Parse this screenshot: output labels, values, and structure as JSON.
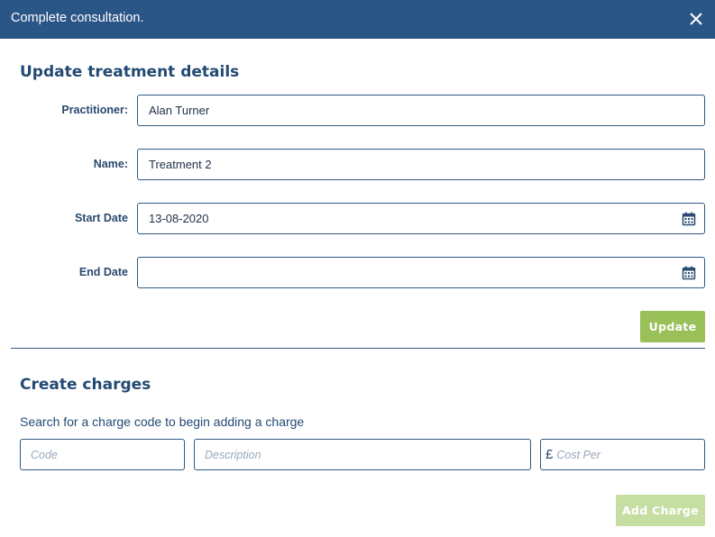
{
  "dialog": {
    "title": "Complete consultation.",
    "close_icon": "close-icon"
  },
  "treatment": {
    "heading": "Update treatment details",
    "practitioner_label": "Practitioner:",
    "practitioner_value": "Alan Turner",
    "name_label": "Name:",
    "name_value": "Treatment 2",
    "start_date_label": "Start Date",
    "start_date_value": "13-08-2020",
    "end_date_label": "End Date",
    "end_date_value": "",
    "calendar_icon": "calendar-icon",
    "update_label": "Update"
  },
  "charges": {
    "heading": "Create charges",
    "help_text": "Search for a charge code to begin adding a charge",
    "code_placeholder": "Code",
    "description_placeholder": "Description",
    "currency_symbol": "£",
    "cost_placeholder": "Cost Per",
    "add_label": "Add Charge"
  },
  "colors": {
    "header": "#2a5587",
    "text": "#234a73",
    "update_button": "#9ac05a",
    "add_button_disabled": "#c7dea3"
  }
}
